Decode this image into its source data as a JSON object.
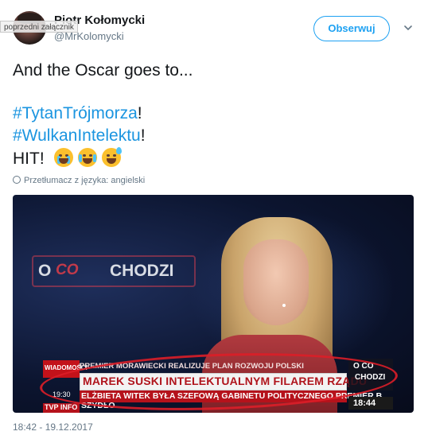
{
  "header": {
    "name": "Piotr Kołomycki",
    "handle": "@MrKolomycki",
    "prev_attachment": "poprzedni załącznik",
    "follow_label": "Obserwuj"
  },
  "tweet": {
    "line1": "And the Oscar goes to...",
    "hashtag1": "#TytanTrójmorza",
    "hashtag1_suffix": "!",
    "hashtag2": "#WulkanIntelektu",
    "hashtag2_suffix": "!",
    "line4": "HIT!",
    "emojis": [
      "loudly-crying-face",
      "face-with-tears-of-joy",
      "grinning-face-with-sweat"
    ],
    "translate": "Przetłumacz z języka: angielski"
  },
  "media": {
    "logo_o": "O",
    "logo_co": "CO",
    "logo_chodzi": "CHODZI",
    "channel_small": "WIADOMOŚCI",
    "top_ticker": "PREMIER MORAWIECKI REALIZUJE PLAN ROZWOJU POLSKI",
    "headline": "MAREK SUSKI INTELEKTUALNYM FILAREM RZĄDU",
    "subline": "ELŻBIETA WITEK BYŁA SZEFOWĄ GABINETU POLITYCZNEGO PREMIER B. SZYDŁO",
    "left_time": "19:30",
    "right_co": "O CO",
    "right_chodzi": "CHODZI",
    "clock": "18:44",
    "tvp": "TVP INFO"
  },
  "footer": {
    "timestamp": "18:42 - 19.12.2017"
  },
  "colors": {
    "link": "#1b95e0",
    "follow": "#1da1f2",
    "muted": "#657786"
  }
}
